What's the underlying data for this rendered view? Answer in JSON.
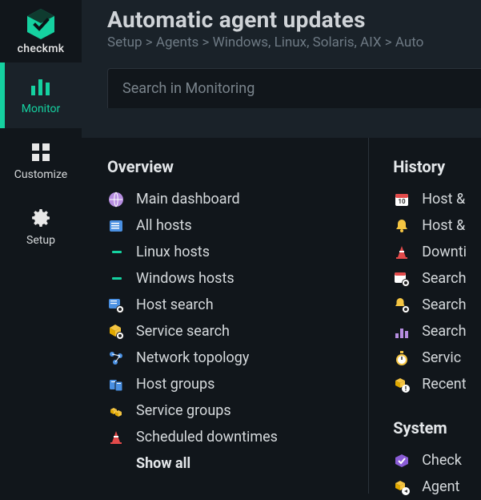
{
  "brand": {
    "name": "checkmk"
  },
  "sidebar": {
    "items": [
      {
        "label": "Monitor"
      },
      {
        "label": "Customize"
      },
      {
        "label": "Setup"
      }
    ]
  },
  "header": {
    "title": "Automatic agent updates",
    "breadcrumb": "Setup > Agents > Windows, Linux, Solaris, AIX > Auto"
  },
  "search": {
    "placeholder": "Search in Monitoring"
  },
  "overview": {
    "title": "Overview",
    "items": [
      {
        "label": "Main dashboard"
      },
      {
        "label": "All hosts"
      },
      {
        "label": "Linux hosts",
        "sub": true
      },
      {
        "label": "Windows hosts",
        "sub": true
      },
      {
        "label": "Host search"
      },
      {
        "label": "Service search"
      },
      {
        "label": "Network topology"
      },
      {
        "label": "Host groups"
      },
      {
        "label": "Service groups"
      },
      {
        "label": "Scheduled downtimes"
      }
    ],
    "show_all": "Show all"
  },
  "history": {
    "title": "History",
    "items": [
      {
        "label": "Host &"
      },
      {
        "label": "Host &"
      },
      {
        "label": "Downti"
      },
      {
        "label": "Search"
      },
      {
        "label": "Search"
      },
      {
        "label": "Search"
      },
      {
        "label": "Servic"
      },
      {
        "label": "Recent"
      }
    ]
  },
  "system": {
    "title": "System",
    "items": [
      {
        "label": "Check"
      },
      {
        "label": "Agent"
      }
    ]
  }
}
